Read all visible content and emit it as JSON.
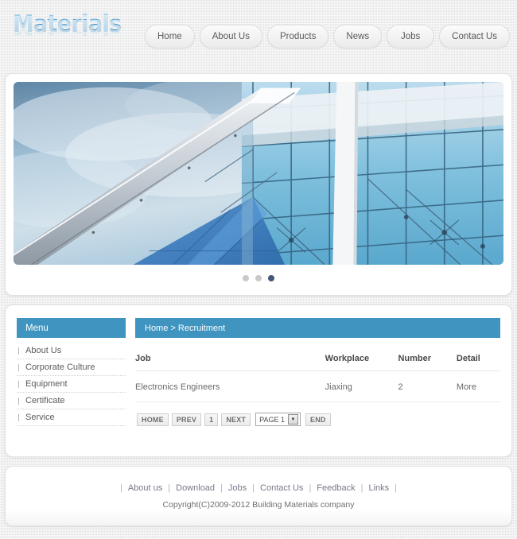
{
  "header": {
    "logo": "Materials",
    "nav": [
      {
        "label": "Home"
      },
      {
        "label": "About Us"
      },
      {
        "label": "Products"
      },
      {
        "label": "News"
      },
      {
        "label": "Jobs"
      },
      {
        "label": "Contact Us"
      }
    ]
  },
  "hero": {
    "alt": "glass-building-facade",
    "slides": [
      {
        "active": false
      },
      {
        "active": false
      },
      {
        "active": true
      }
    ]
  },
  "sidebar": {
    "title": "Menu",
    "items": [
      {
        "label": "About Us"
      },
      {
        "label": "Corporate Culture"
      },
      {
        "label": "Equipment"
      },
      {
        "label": "Certificate"
      },
      {
        "label": "Service"
      }
    ]
  },
  "content": {
    "breadcrumb": "Home > Recruitment",
    "table": {
      "columns": [
        "Job",
        "Workplace",
        "Number",
        "Detail"
      ],
      "rows": [
        {
          "job": "Electronics Engineers",
          "workplace": "Jiaxing",
          "number": "2",
          "detail": "More"
        }
      ]
    },
    "pagination": {
      "home": "HOME",
      "prev": "PREV",
      "current": "1",
      "next": "NEXT",
      "page_select": "PAGE 1",
      "end": "END"
    }
  },
  "footer": {
    "links": [
      "About us",
      "Download",
      "Jobs",
      "Contact Us",
      "Feedback",
      "Links"
    ],
    "copyright": "Copyright(C)2009-2012 Building Materials company"
  },
  "colors": {
    "accent": "#4095c0",
    "logo": "#3f8fc4",
    "dot_active": "#46557a",
    "page_bg": "#ececec"
  }
}
